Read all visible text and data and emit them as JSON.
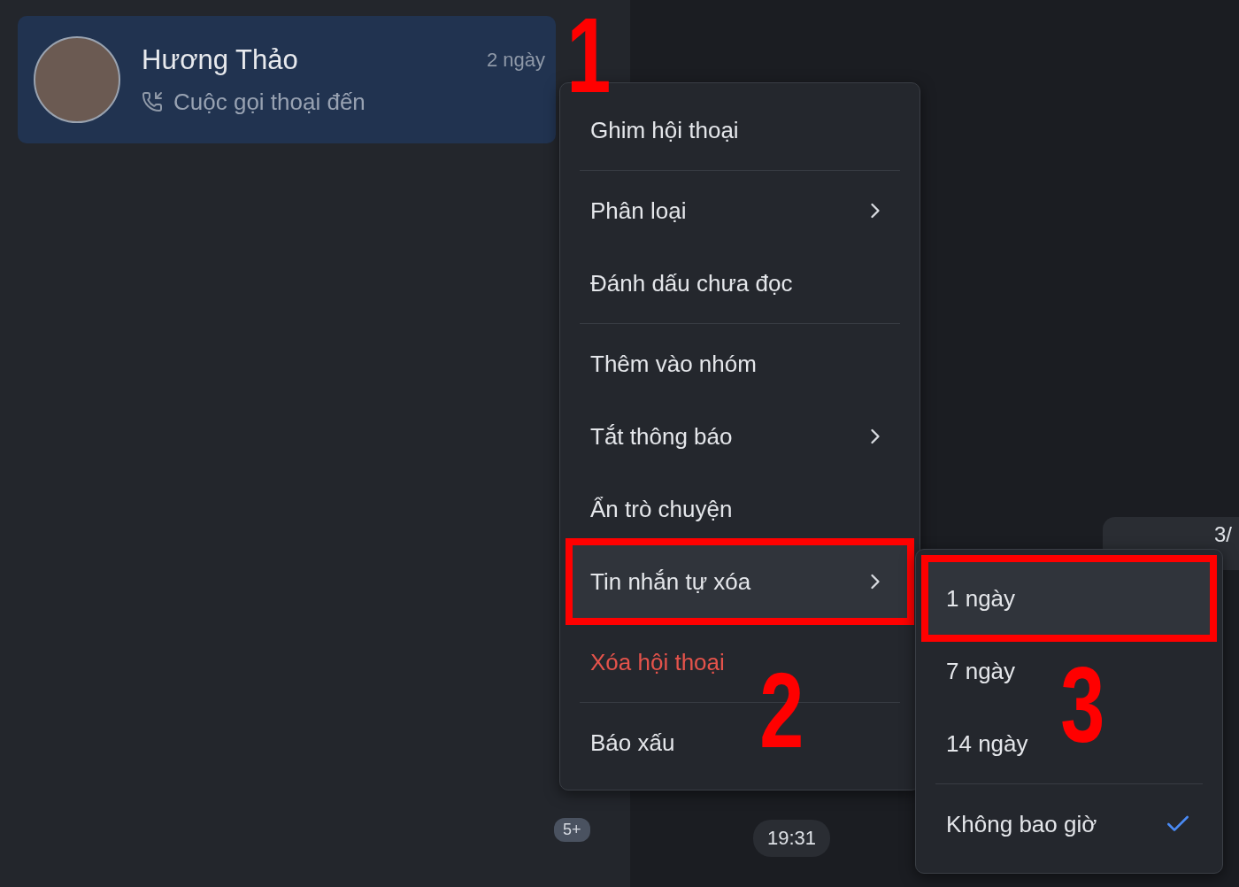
{
  "conversation": {
    "name": "Hương Thảo",
    "time": "2 ngày",
    "preview": "Cuộc gọi thoại đến",
    "selected": true
  },
  "unread_badge": "5+",
  "chat": {
    "bubble_text": "3/",
    "timestamp": "19:31"
  },
  "menu": {
    "groups": [
      [
        {
          "label": "Ghim hội thoại",
          "kind": "normal",
          "submenu": false,
          "highlighted": false,
          "annotated": false
        }
      ],
      [
        {
          "label": "Phân loại",
          "kind": "normal",
          "submenu": true,
          "highlighted": false,
          "annotated": false
        },
        {
          "label": "Đánh dấu chưa đọc",
          "kind": "normal",
          "submenu": false,
          "highlighted": false,
          "annotated": false
        }
      ],
      [
        {
          "label": "Thêm vào nhóm",
          "kind": "normal",
          "submenu": false,
          "highlighted": false,
          "annotated": false
        },
        {
          "label": "Tắt thông báo",
          "kind": "normal",
          "submenu": true,
          "highlighted": false,
          "annotated": false
        },
        {
          "label": "Ẩn trò chuyện",
          "kind": "normal",
          "submenu": false,
          "highlighted": false,
          "annotated": false
        },
        {
          "label": "Tin nhắn tự xóa",
          "kind": "normal",
          "submenu": true,
          "highlighted": true,
          "annotated": true
        }
      ],
      [
        {
          "label": "Xóa hội thoại",
          "kind": "danger",
          "submenu": false,
          "highlighted": false,
          "annotated": false
        }
      ],
      [
        {
          "label": "Báo xấu",
          "kind": "normal",
          "submenu": false,
          "highlighted": false,
          "annotated": false
        }
      ]
    ]
  },
  "submenu": {
    "groups": [
      [
        {
          "label": "1 ngày",
          "selected": false,
          "highlighted": true,
          "annotated": true
        },
        {
          "label": "7 ngày",
          "selected": false,
          "highlighted": false,
          "annotated": false
        },
        {
          "label": "14 ngày",
          "selected": false,
          "highlighted": false,
          "annotated": false
        }
      ],
      [
        {
          "label": "Không bao giờ",
          "selected": true,
          "highlighted": false,
          "annotated": false
        }
      ]
    ]
  },
  "step_numbers": [
    "1",
    "2",
    "3"
  ]
}
